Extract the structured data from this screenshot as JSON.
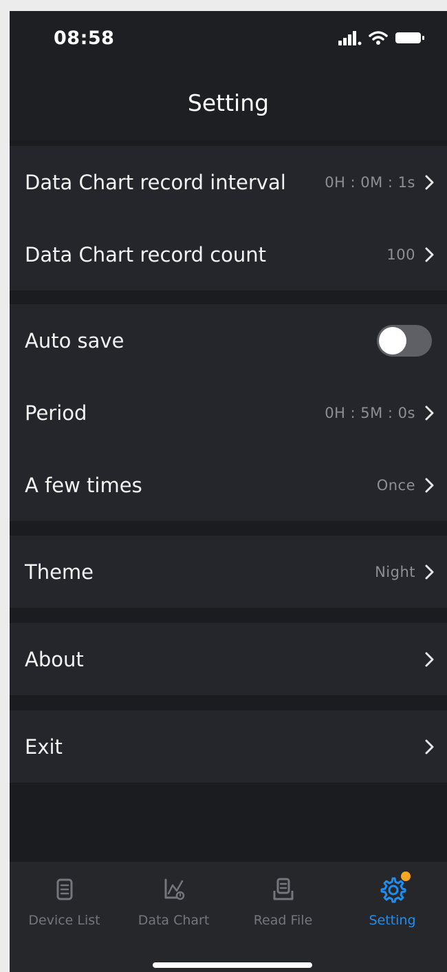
{
  "status_bar": {
    "time": "08:58"
  },
  "header": {
    "title": "Setting"
  },
  "settings": {
    "record_interval": {
      "label": "Data Chart record interval",
      "value": "0H : 0M : 1s"
    },
    "record_count": {
      "label": "Data Chart record count",
      "value": "100"
    },
    "auto_save": {
      "label": "Auto save",
      "enabled": false
    },
    "period": {
      "label": "Period",
      "value": "0H : 5M : 0s"
    },
    "times": {
      "label": "A few times",
      "value": "Once"
    },
    "theme": {
      "label": "Theme",
      "value": "Night"
    },
    "about": {
      "label": "About"
    },
    "exit": {
      "label": "Exit"
    }
  },
  "tabs": [
    {
      "label": "Device List",
      "icon": "device-list-icon",
      "active": false
    },
    {
      "label": "Data Chart",
      "icon": "data-chart-icon",
      "active": false
    },
    {
      "label": "Read File",
      "icon": "read-file-icon",
      "active": false
    },
    {
      "label": "Setting",
      "icon": "gear-icon",
      "active": true
    }
  ],
  "colors": {
    "accent": "#1f8ef1",
    "badge": "#f6a623",
    "background": "#1b1c1f",
    "row_background": "#25262b"
  }
}
